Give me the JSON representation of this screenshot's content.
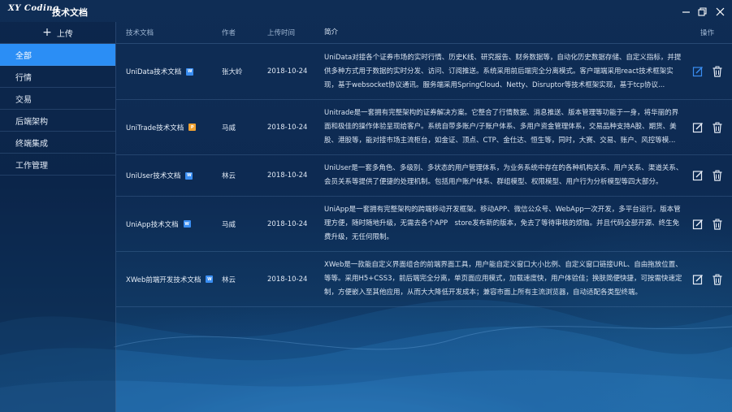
{
  "window": {
    "logo_text": "XY Coding",
    "title": "技术文档"
  },
  "sidebar": {
    "upload_label": "上传",
    "items": [
      {
        "label": "全部",
        "active": true
      },
      {
        "label": "行情",
        "active": false
      },
      {
        "label": "交易",
        "active": false
      },
      {
        "label": "后端架构",
        "active": false
      },
      {
        "label": "终端集成",
        "active": false
      },
      {
        "label": "工作管理",
        "active": false
      }
    ]
  },
  "table": {
    "headers": {
      "name": "技术文档",
      "author": "作者",
      "time": "上传时间",
      "desc": "简介",
      "ops": "操作"
    },
    "rows": [
      {
        "name": "UniData技术文档",
        "file_icon": "word-doc-icon",
        "author": "张大岭",
        "time": "2018-10-24",
        "desc": "UniData对接各个证券市场的实时行情、历史K线、研究报告、财务数据等，自动化历史数据存储、自定义指标，并提供多种方式用于数据的实时分发、访问、订阅推送。系统采用前后端完全分离模式。客户端端采用react技术框架实现，基于websocket协议通讯。服务端采用SpringCloud、Netty、Disruptor等技术框架实现，基于tcp协议..."
      },
      {
        "name": "UniTrade技术文档",
        "file_icon": "ppt-doc-icon",
        "author": "马威",
        "time": "2018-10-24",
        "desc": "Unitrade是一套拥有完整架构的证券解决方案。它整合了行情数据、消息推送、版本管理等功能于一身，将华丽的界面和极佳的操作体验呈现给客户。系统自带多账户/子账户体系、多用户资金管理体系，交易品种支持A股、期货、美股、港股等，能对接市场主流柜台，如金证、顶点、CTP、金仕达、恒生等，同时，大赛、交易、账户、风控等模..."
      },
      {
        "name": "UniUser技术文档",
        "file_icon": "word-doc-icon",
        "author": "林云",
        "time": "2018-10-24",
        "desc": "UniUser是一套多角色、多级别、多状态的用户管理体系，为业务系统中存在的各种机构关系、用户关系、渠道关系、会员关系等提供了便捷的处理机制。包括用户账户体系、群组模型、权限模型、用户行为分析模型等四大部分。"
      },
      {
        "name": "UniApp技术文档",
        "file_icon": "word-doc-icon",
        "author": "马威",
        "time": "2018-10-24",
        "desc": "UniApp是一套拥有完整架构的跨端移动开发框架。移动APP、微信公众号、WebApp一次开发，多平台运行。版本管理方便，随时随地升级，无需去各个APP　store发布新的版本，免去了等待审核的烦恼。并且代码全部开源、终生免费升级，无任何限制。"
      },
      {
        "name": "XWeb前端开发技术文档",
        "file_icon": "word-doc-icon",
        "author": "林云",
        "time": "2018-10-24",
        "desc": "XWeb是一款能自定义界面组合的前端界面工具，用户能自定义窗口大小比例、自定义窗口链接URL、自由拖放位置、等等。采用H5+CSS3，前后端完全分离，单页面应用模式，加载速度快，用户体验佳；换肤简便快捷，可按需快速定制，方便嵌入至其他应用，从而大大降低开发成本；兼容市面上所有主流浏览器，自动适配各类型终端。"
      }
    ]
  },
  "colors": {
    "accent": "#2b8ef5",
    "word_icon": "#3a8ef2",
    "ppt_icon": "#f0a232"
  }
}
